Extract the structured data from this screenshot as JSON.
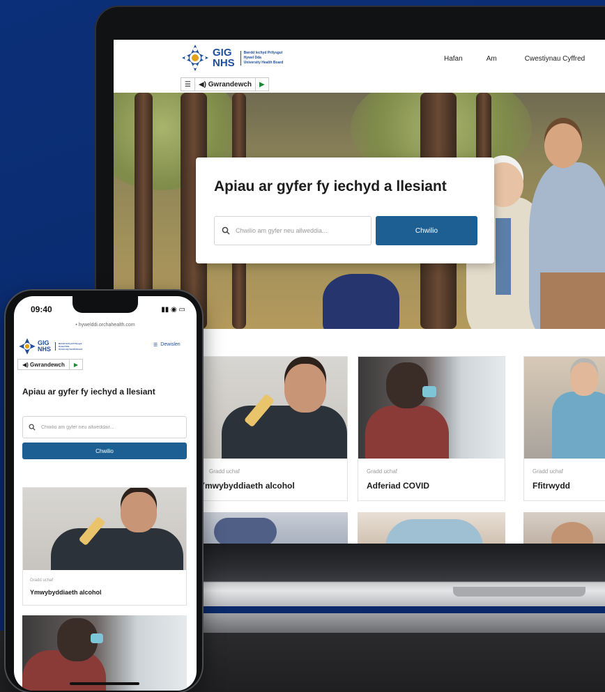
{
  "site": {
    "logo": {
      "gig": "GIG",
      "nhs": "NHS",
      "sub_lines": [
        "Bwrdd Iechyd Prifysgol",
        "Hywel Dda",
        "University Health Board"
      ]
    },
    "nav": [
      "Hafan",
      "Am",
      "Cwestiynau Cyffred"
    ],
    "toolbar": {
      "listen_label": "Gwrandewch"
    },
    "hero": {
      "title": "Apiau ar gyfer fy iechyd a llesiant",
      "search_placeholder": "Chwilio am gyfer neu allweddia...",
      "search_button": "Chwilio"
    },
    "cards": [
      {
        "meta": "Gradd uchaf",
        "title": "Ymwybyddiaeth alcohol"
      },
      {
        "meta": "Gradd uchaf",
        "title": "Adferiad COVID"
      },
      {
        "meta": "Gradd uchaf",
        "title": "Ffitrwydd"
      }
    ]
  },
  "phone": {
    "time": "09:40",
    "status_icons": "▮▮ ◉ ▭",
    "url": "• hywelddi.orchahealth.com",
    "menu_label": "Dewislen",
    "title": "Apiau ar gyfer fy iechyd a llesiant",
    "search_placeholder": "Chwilio am gyfer neu allweddair...",
    "search_button": "Chwilio",
    "card": {
      "meta": "Gradd uchaf",
      "title": "Ymwybyddiaeth alcohol"
    }
  },
  "colors": {
    "background": "#0b2f78",
    "button": "#1e5f93",
    "brand": "#1f4f9a",
    "listen_play": "#1c8a33"
  },
  "icons": [
    "nhs-logo-icon",
    "menu-icon",
    "speaker-icon",
    "play-icon",
    "search-icon"
  ]
}
